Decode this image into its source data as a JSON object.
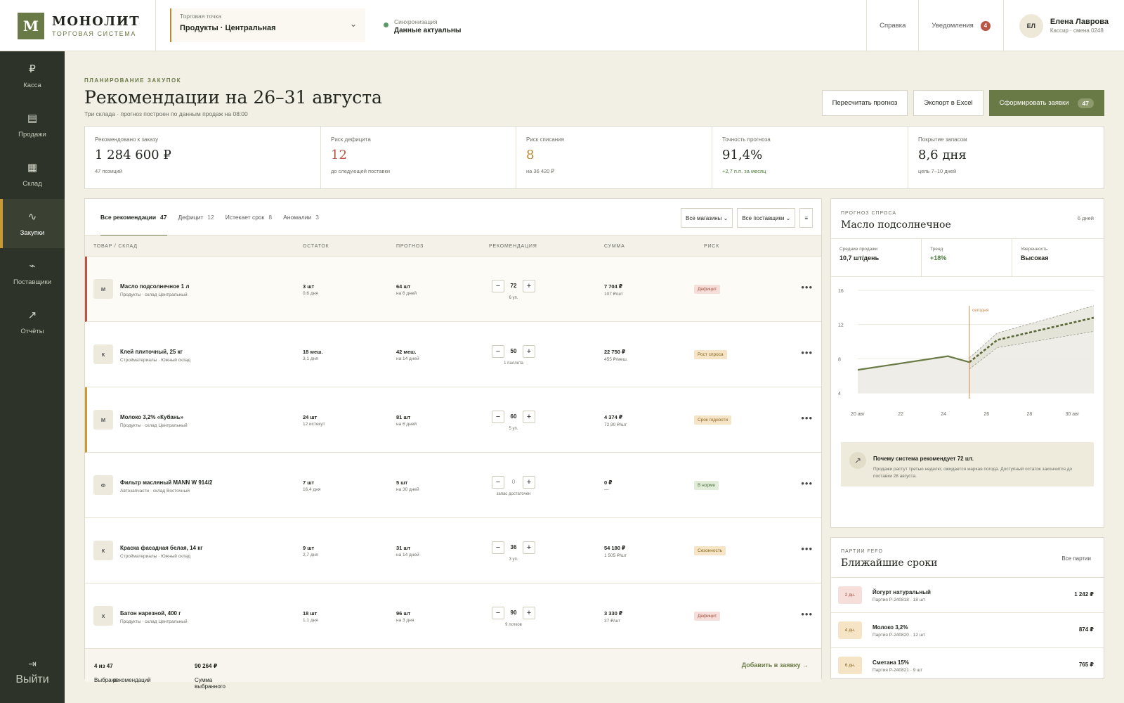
{
  "brand": {
    "mark": "M",
    "name": "МОНОЛИТ",
    "sub": "ТОРГОВАЯ СИСТЕМА"
  },
  "store": {
    "caption": "Торговая точка",
    "value": "Продукты · Центральная"
  },
  "sync": {
    "caption": "Синхронизация",
    "value": "Данные актуальны"
  },
  "header": {
    "help": "Справка",
    "notifications": "Уведомления",
    "notifications_count": "4"
  },
  "user": {
    "initials": "ЕЛ",
    "name": "Елена Лаврова",
    "role": "Кассир · смена 0248"
  },
  "nav": [
    {
      "icon": "₽",
      "label": "Касса"
    },
    {
      "icon": "▤",
      "label": "Продажи"
    },
    {
      "icon": "▦",
      "label": "Склад"
    },
    {
      "icon": "∿",
      "label": "Закупки"
    },
    {
      "icon": "⌁",
      "label": "Поставщики"
    },
    {
      "icon": "↗",
      "label": "Отчёты"
    }
  ],
  "logout": {
    "icon": "⇥",
    "label": "Выйти"
  },
  "page": {
    "eyebrow": "ПЛАНИРОВАНИЕ ЗАКУПОК",
    "title": "Рекомендации на 26–31 августа",
    "subtitle": "Три склада · прогноз построен по данным продаж на 08:00",
    "recalc": "Пересчитать прогноз",
    "export": "Экспорт в Excel",
    "create": "Сформировать заявки",
    "create_count": "47"
  },
  "kpis": [
    {
      "caption": "Рекомендовано к заказу",
      "value": "1 284 600 ₽",
      "sub": "47 позиций"
    },
    {
      "caption": "Риск дефицита",
      "value": "12",
      "sub": "до следующей поставки"
    },
    {
      "caption": "Риск списания",
      "value": "8",
      "sub": "на 36 420 ₽"
    },
    {
      "caption": "Точность прогноза",
      "value": "91,4%",
      "sub": "+2,7 п.п. за месяц"
    },
    {
      "caption": "Покрытие запасом",
      "value": "8,6 дня",
      "sub": "цель 7–10 дней"
    }
  ],
  "tabs": [
    {
      "label": "Все рекомендации",
      "count": "47"
    },
    {
      "label": "Дефицит",
      "count": "12"
    },
    {
      "label": "Истекает срок",
      "count": "8"
    },
    {
      "label": "Аномалии",
      "count": "3"
    }
  ],
  "filters": {
    "stores": "Все магазины ⌄",
    "suppliers": "Все поставщики ⌄",
    "more": "≡"
  },
  "columns": {
    "product": "ТОВАР / СКЛАД",
    "stock": "ОСТАТОК",
    "forecast": "ПРОГНОЗ",
    "recommendation": "РЕКОМЕНДАЦИЯ",
    "sum": "СУММА",
    "risk": "РИСК"
  },
  "rows": [
    {
      "initial": "М",
      "name": "Масло подсолнечное 1 л",
      "meta": "Продукты · склад Центральный",
      "stock": "3 шт",
      "stock_sub": "0,6 дня",
      "forecast": "64 шт",
      "forecast_sub": "на 6 дней",
      "qty": "72",
      "qty_note": "6 уп.",
      "sum": "7 704 ₽",
      "sum_sub": "107 ₽/шт",
      "risk": "Дефицит"
    },
    {
      "initial": "К",
      "name": "Клей плиточный, 25 кг",
      "meta": "Стройматериалы · Южный склад",
      "stock": "18 меш.",
      "stock_sub": "3,1 дня",
      "forecast": "42 меш.",
      "forecast_sub": "на 14 дней",
      "qty": "50",
      "qty_note": "1 паллета",
      "sum": "22 750 ₽",
      "sum_sub": "455 ₽/меш.",
      "risk": "Рост спроса"
    },
    {
      "initial": "М",
      "name": "Молоко 3,2% «Кубань»",
      "meta": "Продукты · склад Центральный",
      "stock": "24 шт",
      "stock_sub": "12 истекут",
      "forecast": "81 шт",
      "forecast_sub": "на 6 дней",
      "qty": "60",
      "qty_note": "5 уп.",
      "sum": "4 374 ₽",
      "sum_sub": "72,90 ₽/шт",
      "risk": "Срок годности"
    },
    {
      "initial": "Ф",
      "name": "Фильтр масляный MANN W 914/2",
      "meta": "Автозапчасти · склад Восточный",
      "stock": "7 шт",
      "stock_sub": "16,4 дня",
      "forecast": "5 шт",
      "forecast_sub": "на 30 дней",
      "qty": "0",
      "qty_note": "запас достаточен",
      "sum": "0 ₽",
      "sum_sub": "—",
      "risk": "В норме"
    },
    {
      "initial": "К",
      "name": "Краска фасадная белая, 14 кг",
      "meta": "Стройматериалы · Южный склад",
      "stock": "9 шт",
      "stock_sub": "2,7 дня",
      "forecast": "31 шт",
      "forecast_sub": "на 14 дней",
      "qty": "36",
      "qty_note": "3 уп.",
      "sum": "54 180 ₽",
      "sum_sub": "1 505 ₽/шт",
      "risk": "Сезонность"
    },
    {
      "initial": "Х",
      "name": "Батон нарезной, 400 г",
      "meta": "Продукты · склад Центральный",
      "stock": "18 шт",
      "stock_sub": "1,1 дня",
      "forecast": "96 шт",
      "forecast_sub": "на 3 дня",
      "qty": "90",
      "qty_note": "9 лотков",
      "sum": "3 330 ₽",
      "sum_sub": "37 ₽/шт",
      "risk": "Дефицит"
    }
  ],
  "footer": {
    "selected_prefix": "Выбрано",
    "selected_a": "4 из 47",
    "selected_suffix": "рекомендаций",
    "sum_label": "Сумма выбранного",
    "sum_value": "90 264 ₽",
    "add": "Добавить в заявку →"
  },
  "forecast": {
    "caption": "ПРОГНОЗ СПРОСА",
    "days": "6 дней",
    "title": "Масло подсолнечное",
    "stats": [
      {
        "caption": "Средние продажи",
        "value": "10,7 шт/день"
      },
      {
        "caption": "Тренд",
        "value": "+18%"
      },
      {
        "caption": "Уверенность",
        "value": "Высокая"
      }
    ],
    "why_title": "Почему система рекомендует 72 шт.",
    "why_text": "Продажи растут третью неделю; ожидается жаркая погода. Доступный остаток закончится до поставки 28 августа."
  },
  "chart_data": {
    "type": "line",
    "today_label": "сегодня",
    "x_ticks": [
      "20 авг",
      "22",
      "24",
      "26",
      "28",
      "30 авг"
    ],
    "y_ticks": [
      4,
      8,
      12,
      16
    ],
    "ylim": [
      4,
      16
    ],
    "xlim": [
      20,
      31
    ],
    "today_x": 25.2,
    "actual": {
      "x": [
        20,
        24.2,
        25.2
      ],
      "y": [
        6.7,
        8.3,
        7.6
      ]
    },
    "forecast": {
      "x": [
        25.2,
        26.5,
        31
      ],
      "y": [
        7.6,
        10.2,
        12.8
      ]
    },
    "upper": {
      "x": [
        25.2,
        26.5,
        31
      ],
      "y": [
        8.1,
        11,
        14.2
      ]
    },
    "lower": {
      "x": [
        25.2,
        26.5,
        31
      ],
      "y": [
        6.8,
        9.3,
        11.2
      ]
    },
    "grid": true,
    "colors": {
      "actual": "#6a7a46",
      "forecast": "#5a6838",
      "today": "#c98a4a"
    }
  },
  "fefo": {
    "caption": "ПАРТИИ FEFO",
    "title": "Ближайшие сроки",
    "all": "Все партии",
    "items": [
      {
        "days": "2 дн.",
        "name": "Йогурт натуральный",
        "meta": "Партия P-240818 · 18 шт",
        "amount": "1 242 ₽"
      },
      {
        "days": "4 дн.",
        "name": "Молоко 3,2%",
        "meta": "Партия P-240820 · 12 шт",
        "amount": "874 ₽"
      },
      {
        "days": "6 дн.",
        "name": "Сметана 15%",
        "meta": "Партия P-240821 · 9 шт",
        "amount": "765 ₽"
      }
    ]
  }
}
